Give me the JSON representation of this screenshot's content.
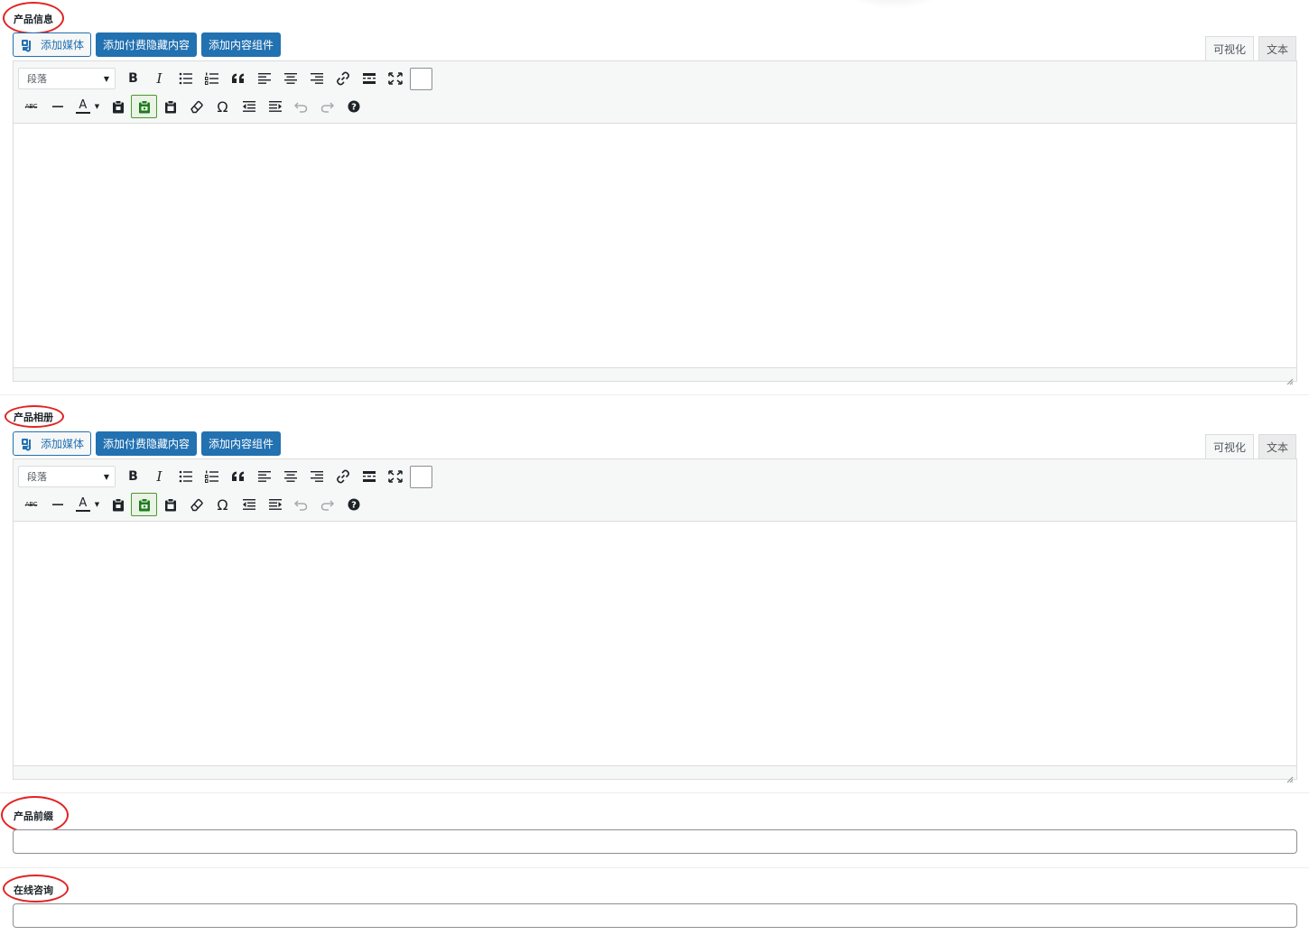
{
  "sections": [
    {
      "label": "产品信息",
      "media_buttons": {
        "add_media": "添加媒体",
        "paid_hidden": "添加付费隐藏内容",
        "content_widget": "添加内容组件"
      },
      "tabs": {
        "visual": "可视化",
        "text": "文本",
        "active": "visual"
      },
      "format_select": "段落"
    },
    {
      "label": "产品相册",
      "media_buttons": {
        "add_media": "添加媒体",
        "paid_hidden": "添加付费隐藏内容",
        "content_widget": "添加内容组件"
      },
      "tabs": {
        "visual": "可视化",
        "text": "文本",
        "active": "visual"
      },
      "format_select": "段落"
    },
    {
      "label": "产品前缀",
      "input_value": ""
    },
    {
      "label": "在线咨询",
      "input_value": ""
    }
  ],
  "toolbar": {
    "row1_icons": [
      "bold-icon",
      "italic-icon",
      "bullet-list-icon",
      "numbered-list-icon",
      "blockquote-icon",
      "align-left-icon",
      "align-center-icon",
      "align-right-icon",
      "link-icon",
      "read-more-icon",
      "fullscreen-icon",
      "toolbar-toggle-icon"
    ],
    "row2_icons": [
      "strikethrough-icon",
      "horizontal-line-icon",
      "text-color-icon",
      "paste-icon",
      "paste-widget-icon",
      "paste-text-icon",
      "clear-format-icon",
      "special-char-icon",
      "outdent-icon",
      "indent-icon",
      "undo-icon",
      "redo-icon",
      "help-icon"
    ],
    "labels": {
      "bold": "B",
      "italic": "I",
      "strike": "ABC",
      "omega": "Ω",
      "text_color": "A"
    }
  },
  "colors": {
    "primary": "#2271b1",
    "annotation_red": "#e02424",
    "active_green": "#4a9a2d"
  }
}
